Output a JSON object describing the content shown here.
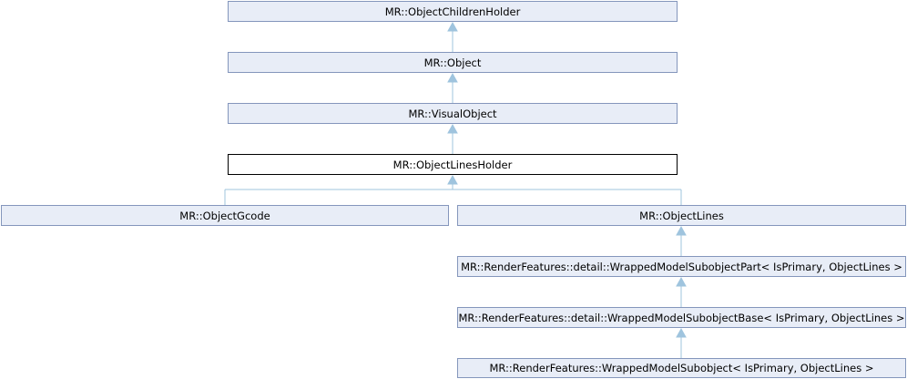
{
  "diagram": {
    "nodes": {
      "children_holder": "MR::ObjectChildrenHolder",
      "object": "MR::Object",
      "visual_object": "MR::VisualObject",
      "lines_holder": "MR::ObjectLinesHolder",
      "gcode": "MR::ObjectGcode",
      "lines": "MR::ObjectLines",
      "wrapped_part": "MR::RenderFeatures::detail::WrappedModelSubobjectPart< IsPrimary, ObjectLines >",
      "wrapped_base": "MR::RenderFeatures::detail::WrappedModelSubobjectBase< IsPrimary, ObjectLines >",
      "wrapped_subobject": "MR::RenderFeatures::WrappedModelSubobject< IsPrimary, ObjectLines >"
    },
    "colors": {
      "node_fill": "#e8edf7",
      "node_border": "#8496bc",
      "current_fill": "#ffffff",
      "current_border": "#000000",
      "edge": "#9fc4de"
    }
  }
}
